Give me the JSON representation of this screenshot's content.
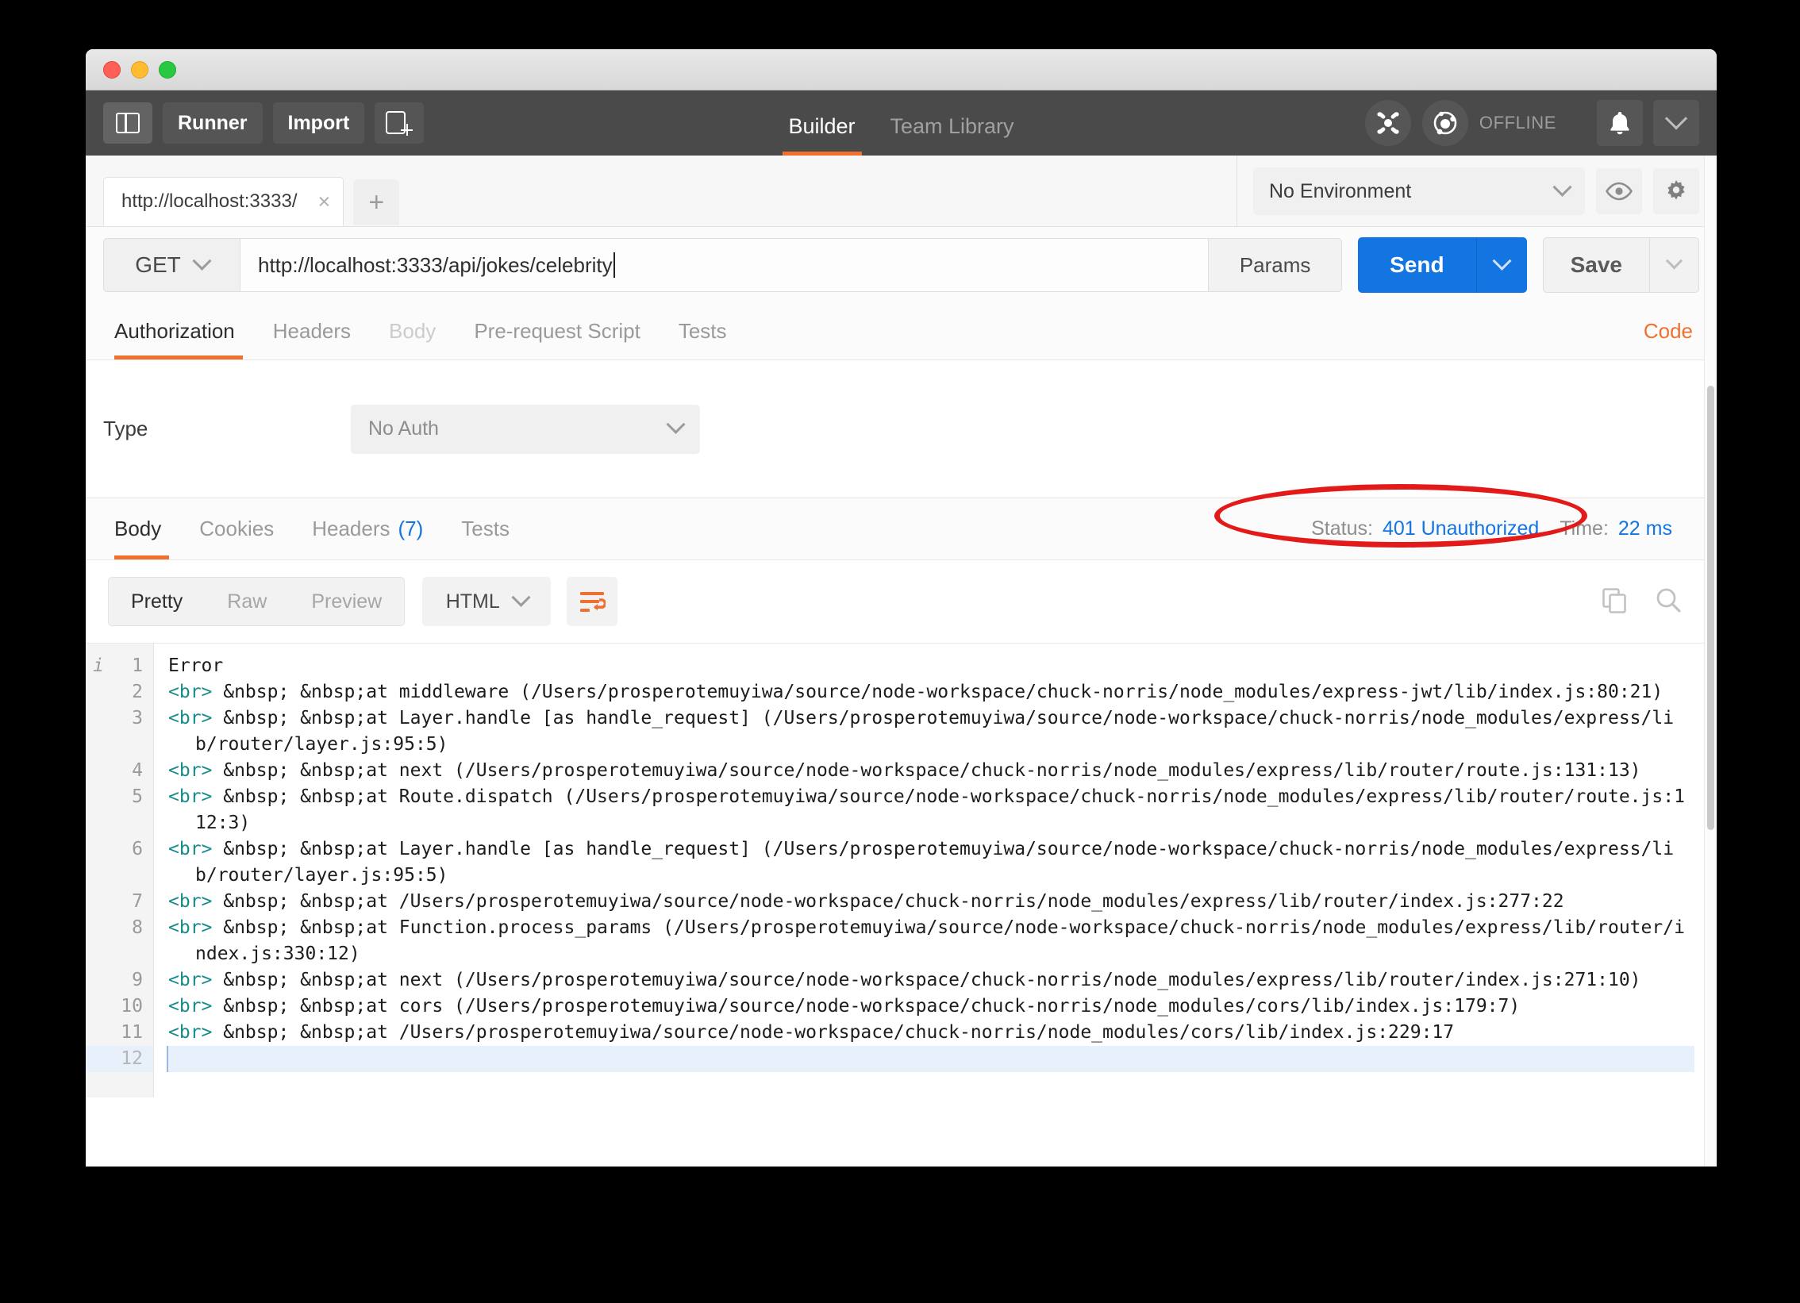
{
  "window": {
    "traffic_lights": [
      "close",
      "minimize",
      "maximize"
    ]
  },
  "header": {
    "sidebar_toggle": "sidebar-toggle",
    "runner_label": "Runner",
    "import_label": "Import",
    "new_tab_label": "new-request",
    "tabs": [
      {
        "label": "Builder",
        "active": true
      },
      {
        "label": "Team Library",
        "active": false
      }
    ],
    "interceptor_icon": "interceptor-icon",
    "sync_icon": "sync-icon",
    "status_label": "OFFLINE",
    "bell_icon": "bell-icon",
    "account_caret": "chevron-down-icon"
  },
  "tabstrip": {
    "request_tab_label": "http://localhost:3333/",
    "close_glyph": "×",
    "add_glyph": "+"
  },
  "environment": {
    "selected": "No Environment",
    "eye_icon": "eye-icon",
    "gear_icon": "gear-icon"
  },
  "request": {
    "method": "GET",
    "url": "http://localhost:3333/api/jokes/celebrity",
    "params_label": "Params",
    "send_label": "Send",
    "save_label": "Save",
    "tabs": [
      {
        "label": "Authorization",
        "active": true,
        "dim": false
      },
      {
        "label": "Headers",
        "active": false,
        "dim": false
      },
      {
        "label": "Body",
        "active": false,
        "dim": true
      },
      {
        "label": "Pre-request Script",
        "active": false,
        "dim": false
      },
      {
        "label": "Tests",
        "active": false,
        "dim": false
      }
    ],
    "code_link": "Code"
  },
  "auth": {
    "type_label": "Type",
    "type_value": "No Auth"
  },
  "response": {
    "tabs": [
      {
        "label": "Body",
        "active": true,
        "count": ""
      },
      {
        "label": "Cookies",
        "active": false,
        "count": ""
      },
      {
        "label": "Headers",
        "active": false,
        "count": "(7)"
      },
      {
        "label": "Tests",
        "active": false,
        "count": ""
      }
    ],
    "status_key": "Status:",
    "status_value": "401 Unauthorized",
    "time_key": "Time:",
    "time_value": "22 ms",
    "annotation": {
      "shape": "ellipse",
      "color": "#e31a1a"
    }
  },
  "body_toolbar": {
    "view_modes": [
      {
        "label": "Pretty",
        "active": true
      },
      {
        "label": "Raw",
        "active": false
      },
      {
        "label": "Preview",
        "active": false
      }
    ],
    "format": "HTML",
    "wrap_icon": "word-wrap-icon",
    "copy_icon": "copy-icon",
    "search_icon": "search-icon"
  },
  "code_viewer": {
    "gutter_info_glyph": "i",
    "lines": [
      {
        "n": "1",
        "current": false,
        "parts": [
          {
            "t": "text",
            "v": "Error"
          }
        ]
      },
      {
        "n": "2",
        "current": false,
        "parts": [
          {
            "t": "tag",
            "v": "<br>"
          },
          {
            "t": "text",
            "v": " &nbsp; &nbsp;at middleware (/Users/prosperotemuyiwa/source/node-workspace/chuck-norris/node_modules/express-jwt/lib/index.js:80:21)"
          }
        ]
      },
      {
        "n": "3",
        "current": false,
        "parts": [
          {
            "t": "tag",
            "v": "<br>"
          },
          {
            "t": "text",
            "v": " &nbsp; &nbsp;at Layer.handle [as handle_request] (/Users/prosperotemuyiwa/source/node-workspace/chuck-norris/node_modules/express/lib/router/layer.js:95:5)"
          }
        ]
      },
      {
        "n": "4",
        "current": false,
        "parts": [
          {
            "t": "tag",
            "v": "<br>"
          },
          {
            "t": "text",
            "v": " &nbsp; &nbsp;at next (/Users/prosperotemuyiwa/source/node-workspace/chuck-norris/node_modules/express/lib/router/route.js:131:13)"
          }
        ]
      },
      {
        "n": "5",
        "current": false,
        "parts": [
          {
            "t": "tag",
            "v": "<br>"
          },
          {
            "t": "text",
            "v": " &nbsp; &nbsp;at Route.dispatch (/Users/prosperotemuyiwa/source/node-workspace/chuck-norris/node_modules/express/lib/router/route.js:112:3)"
          }
        ]
      },
      {
        "n": "6",
        "current": false,
        "parts": [
          {
            "t": "tag",
            "v": "<br>"
          },
          {
            "t": "text",
            "v": " &nbsp; &nbsp;at Layer.handle [as handle_request] (/Users/prosperotemuyiwa/source/node-workspace/chuck-norris/node_modules/express/lib/router/layer.js:95:5)"
          }
        ]
      },
      {
        "n": "7",
        "current": false,
        "parts": [
          {
            "t": "tag",
            "v": "<br>"
          },
          {
            "t": "text",
            "v": " &nbsp; &nbsp;at /Users/prosperotemuyiwa/source/node-workspace/chuck-norris/node_modules/express/lib/router/index.js:277:22"
          }
        ]
      },
      {
        "n": "8",
        "current": false,
        "parts": [
          {
            "t": "tag",
            "v": "<br>"
          },
          {
            "t": "text",
            "v": " &nbsp; &nbsp;at Function.process_params (/Users/prosperotemuyiwa/source/node-workspace/chuck-norris/node_modules/express/lib/router/index.js:330:12)"
          }
        ]
      },
      {
        "n": "9",
        "current": false,
        "parts": [
          {
            "t": "tag",
            "v": "<br>"
          },
          {
            "t": "text",
            "v": " &nbsp; &nbsp;at next (/Users/prosperotemuyiwa/source/node-workspace/chuck-norris/node_modules/express/lib/router/index.js:271:10)"
          }
        ]
      },
      {
        "n": "10",
        "current": false,
        "parts": [
          {
            "t": "tag",
            "v": "<br>"
          },
          {
            "t": "text",
            "v": " &nbsp; &nbsp;at cors (/Users/prosperotemuyiwa/source/node-workspace/chuck-norris/node_modules/cors/lib/index.js:179:7)"
          }
        ]
      },
      {
        "n": "11",
        "current": false,
        "parts": [
          {
            "t": "tag",
            "v": "<br>"
          },
          {
            "t": "text",
            "v": " &nbsp; &nbsp;at /Users/prosperotemuyiwa/source/node-workspace/chuck-norris/node_modules/cors/lib/index.js:229:17"
          }
        ]
      },
      {
        "n": "12",
        "current": true,
        "parts": []
      }
    ]
  }
}
